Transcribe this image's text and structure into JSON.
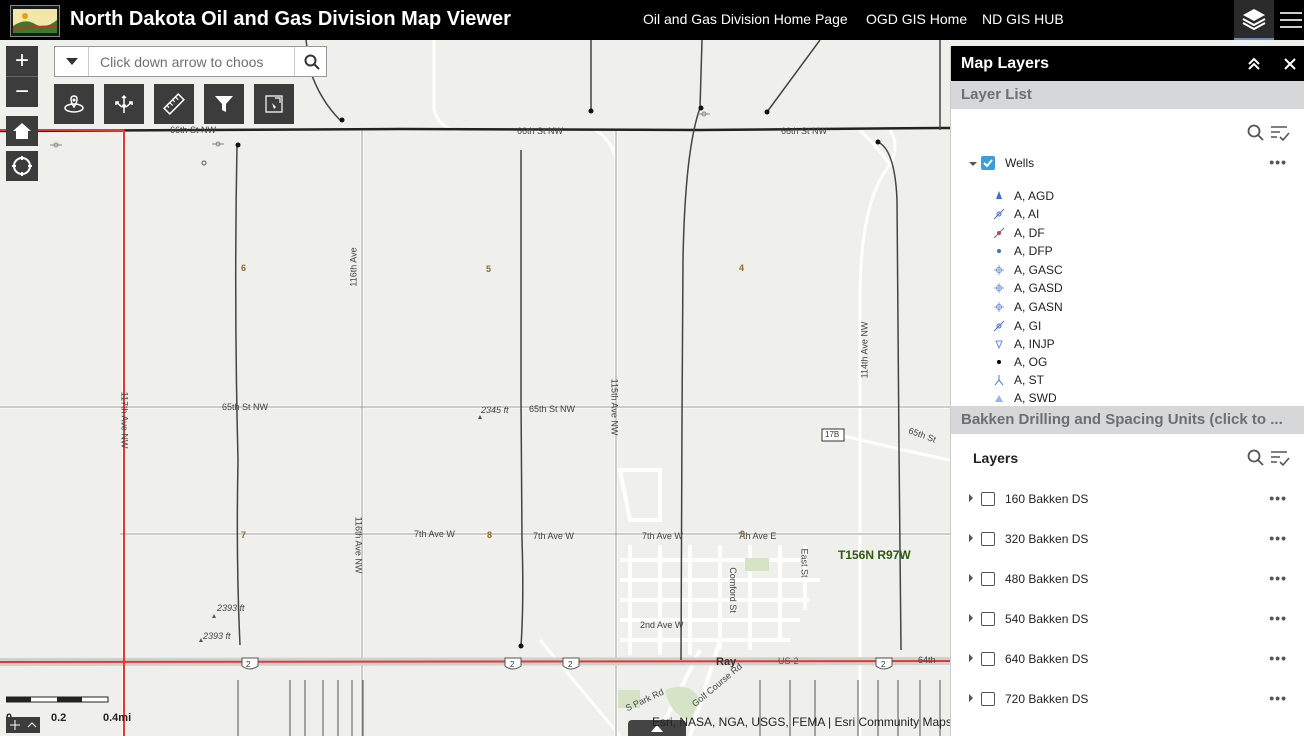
{
  "header": {
    "title": "North Dakota Oil and Gas Division Map Viewer",
    "links": [
      "Oil and Gas Division Home Page",
      "OGD GIS Home",
      "ND GIS HUB"
    ]
  },
  "toolbar": {
    "zoom_in": "+",
    "zoom_out": "−",
    "search_placeholder": "Click down arrow to choos"
  },
  "panel": {
    "title": "Map Layers",
    "layer_list_heading": "Layer List",
    "wells_layer": "Wells",
    "well_types": [
      "A, AGD",
      "A, AI",
      "A, DF",
      "A, DFP",
      "A, GASC",
      "A, GASD",
      "A, GASN",
      "A, GI",
      "A, INJP",
      "A, OG",
      "A, ST",
      "A, SWD"
    ],
    "bakken_heading": "Bakken Drilling and Spacing Units (click to ...",
    "layers_heading": "Layers",
    "bakken_layers": [
      "160 Bakken DS",
      "320 Bakken DS",
      "480 Bakken DS",
      "540 Bakken DS",
      "640 Bakken DS",
      "720 Bakken DS"
    ],
    "more_label": "•••"
  },
  "map": {
    "roads": {
      "r66_left": "66th St NW",
      "r66_mid": "66th St NW",
      "r66_right": "66th St NW",
      "r65_left": "65th St NW",
      "r65_mid": "65th St NW",
      "r116_top": "116th Ave",
      "r116_bottom": "116th Ave NW",
      "r115": "115th Ave NW",
      "r114": "114th Ave NW",
      "r117": "117th Ave NW",
      "r65th_right": "65th St",
      "seventh_left": "7th Ave W",
      "seventh_mid": "7th Ave W",
      "seventh_mid2": "7th Ave W",
      "seventh_e": "7th Ave E",
      "second": "2nd Ave W",
      "comford": "Comford St",
      "east": "East St",
      "park": "S Park Rd",
      "golf": "Golf Course Rd",
      "us2": "US-2",
      "sixty4": "64th"
    },
    "sections": [
      "6",
      "5",
      "4",
      "7",
      "8",
      "9"
    ],
    "elevations": [
      "2345 ft",
      "2393 ft",
      "2393 ft"
    ],
    "town": "Ray",
    "township": "T156N R97W",
    "shields": [
      "2",
      "2",
      "2",
      "2",
      "17B"
    ],
    "scale_labels": [
      "0",
      "0.2",
      "0.4mi"
    ],
    "attribution": "Esri, NASA, NGA, USGS, FEMA | Esri Community Maps Contributors, State of N"
  }
}
